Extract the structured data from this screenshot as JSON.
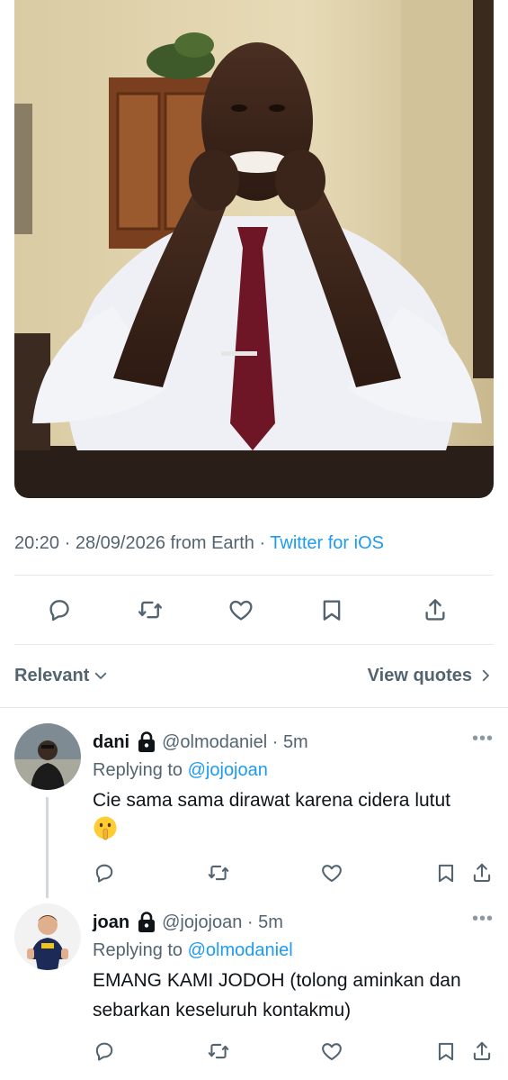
{
  "tweet": {
    "media_description_icon": "photo",
    "time": "20:20",
    "date": "28/09/2026",
    "location_text": "from Earth",
    "source": "Twitter for iOS"
  },
  "actions": {
    "icons": [
      "reply-icon",
      "retweet-icon",
      "like-icon",
      "bookmark-icon",
      "share-icon"
    ]
  },
  "sort": {
    "label": "Relevant",
    "view_quotes": "View quotes"
  },
  "replies": [
    {
      "name": "dani",
      "handle": "@olmodaniel",
      "time": "5m",
      "replying_prefix": "Replying to",
      "replying_to": "@jojojoan",
      "text": "Cie sama sama dirawat karena cidera lutut",
      "emoji": "shushing-face"
    },
    {
      "name": "joan",
      "handle": "@jojojoan",
      "time": "5m",
      "replying_prefix": "Replying to",
      "replying_to": "@olmodaniel",
      "text": "EMANG KAMI JODOH (tolong aminkan dan sebarkan keseluruh kontakmu)"
    }
  ],
  "colors": {
    "link": "#1d9bf0",
    "muted": "#536471",
    "text": "#0f1419",
    "divider": "#e6e9ec"
  }
}
